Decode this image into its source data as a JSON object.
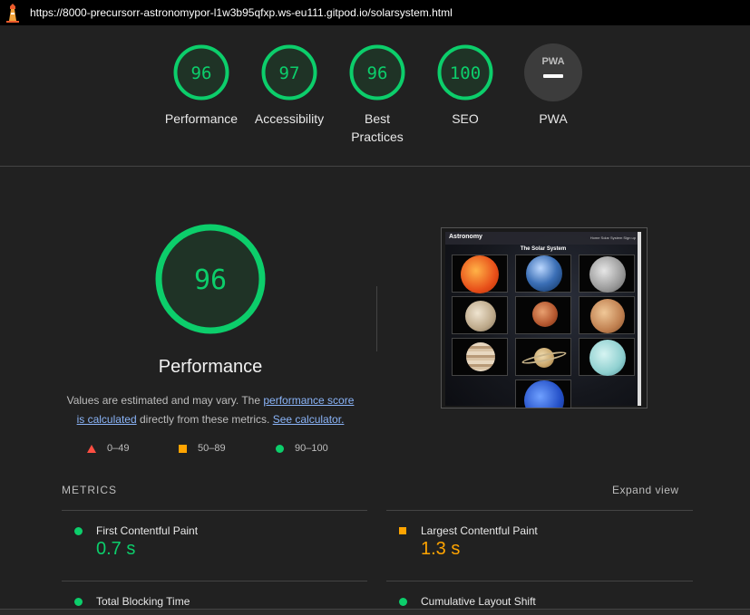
{
  "browser": {
    "url": "https://8000-precursorr-astronomypor-l1w3b95qfxp.ws-eu111.gitpod.io/solarsystem.html",
    "logo_icon": "lighthouse-icon"
  },
  "categories": [
    {
      "id": "performance",
      "score": "96",
      "label": "Performance",
      "status": "pass"
    },
    {
      "id": "accessibility",
      "score": "97",
      "label": "Accessibility",
      "status": "pass"
    },
    {
      "id": "best-practices",
      "score": "96",
      "label": "Best Practices",
      "status": "pass"
    },
    {
      "id": "seo",
      "score": "100",
      "label": "SEO",
      "status": "pass"
    },
    {
      "id": "pwa",
      "badge": "PWA",
      "label": "PWA",
      "status": "neutral"
    }
  ],
  "main": {
    "score": "96",
    "title": "Performance",
    "desc_1": "Values are estimated and may vary. The ",
    "link_perf_score_1": "performance score",
    "link_perf_score_2": "is calculated",
    "desc_2": " directly from these metrics. ",
    "link_calculator": "See calculator.",
    "legend": {
      "fail": "0–49",
      "average": "50–89",
      "pass": "90–100"
    }
  },
  "screenshot": {
    "brand": "Astronomy",
    "nav_links": "Home   Solar System   Sign up",
    "heading": "The Solar System"
  },
  "metrics": {
    "label": "METRICS",
    "expand": "Expand view",
    "items": [
      {
        "name": "First Contentful Paint",
        "value": "0.7 s",
        "status": "pass"
      },
      {
        "name": "Largest Contentful Paint",
        "value": "1.3 s",
        "status": "average"
      },
      {
        "name": "Total Blocking Time",
        "value": "",
        "status": "pass"
      },
      {
        "name": "Cumulative Layout Shift",
        "value": "",
        "status": "pass"
      }
    ]
  },
  "colors": {
    "pass": "#0cce6b",
    "average": "#ffa400",
    "fail": "#ff4e42",
    "link": "#8ab4f8",
    "background": "#212121"
  }
}
